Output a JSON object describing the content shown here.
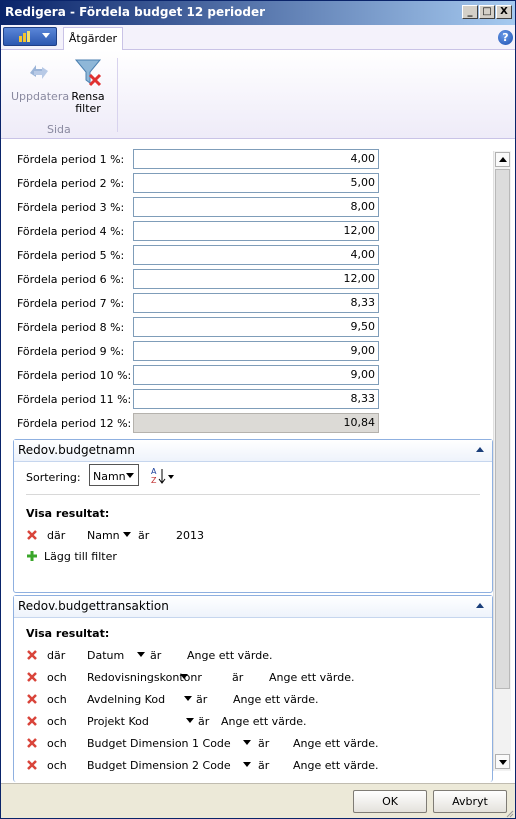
{
  "window": {
    "title": "Redigera - Fördela budget 12 perioder"
  },
  "caption_buttons": {
    "minimize": "_",
    "maximize": "□",
    "close": "X"
  },
  "ribbon": {
    "tab_label": "Åtgärder",
    "help_label": "?",
    "buttons": {
      "update": "Uppdatera",
      "clear_filter_line1": "Rensa",
      "clear_filter_line2": "filter"
    },
    "group_label": "Sida"
  },
  "periods": [
    {
      "label": "Fördela period 1 %:",
      "value": "4,00"
    },
    {
      "label": "Fördela period 2 %:",
      "value": "5,00"
    },
    {
      "label": "Fördela period 3 %:",
      "value": "8,00"
    },
    {
      "label": "Fördela period 4 %:",
      "value": "12,00"
    },
    {
      "label": "Fördela period 5 %:",
      "value": "4,00"
    },
    {
      "label": "Fördela period 6 %:",
      "value": "12,00"
    },
    {
      "label": "Fördela period 7 %:",
      "value": "8,33"
    },
    {
      "label": "Fördela period 8 %:",
      "value": "9,50"
    },
    {
      "label": "Fördela period 9 %:",
      "value": "9,00"
    },
    {
      "label": "Fördela period 10 %:",
      "value": "9,00"
    },
    {
      "label": "Fördela period 11 %:",
      "value": "8,33"
    },
    {
      "label": "Fördela period 12 %:",
      "value": "10,84"
    }
  ],
  "budget_name_panel": {
    "title": "Redov.budgetnamn",
    "sort_label": "Sortering:",
    "sort_value": "Namn",
    "results_label": "Visa resultat:",
    "filter": {
      "prefix": "där",
      "field": "Namn",
      "op": "är",
      "value": "2013"
    },
    "add_filter_label": "Lägg till filter"
  },
  "budget_entry_panel": {
    "title": "Redov.budgettransaktion",
    "results_label": "Visa resultat:",
    "filters": [
      {
        "prefix": "där",
        "field": "Datum",
        "op": "är",
        "value": "Ange ett värde."
      },
      {
        "prefix": "och",
        "field": "Redovisningskontonr",
        "op": "är",
        "value": "Ange ett värde."
      },
      {
        "prefix": "och",
        "field": "Avdelning Kod",
        "op": "är",
        "value": "Ange ett värde."
      },
      {
        "prefix": "och",
        "field": "Projekt Kod",
        "op": "är",
        "value": "Ange ett värde."
      },
      {
        "prefix": "och",
        "field": "Budget Dimension 1 Code",
        "op": "är",
        "value": "Ange ett värde."
      },
      {
        "prefix": "och",
        "field": "Budget Dimension 2 Code",
        "op": "är",
        "value": "Ange ett värde."
      }
    ]
  },
  "footer": {
    "ok": "OK",
    "cancel": "Avbryt"
  },
  "colors": {
    "title_bar_start": "#0a246a",
    "title_bar_end": "#a6caf0",
    "panel_border": "#8fb0e0",
    "remove_icon": "#d9443a",
    "add_icon": "#3aa62a"
  }
}
